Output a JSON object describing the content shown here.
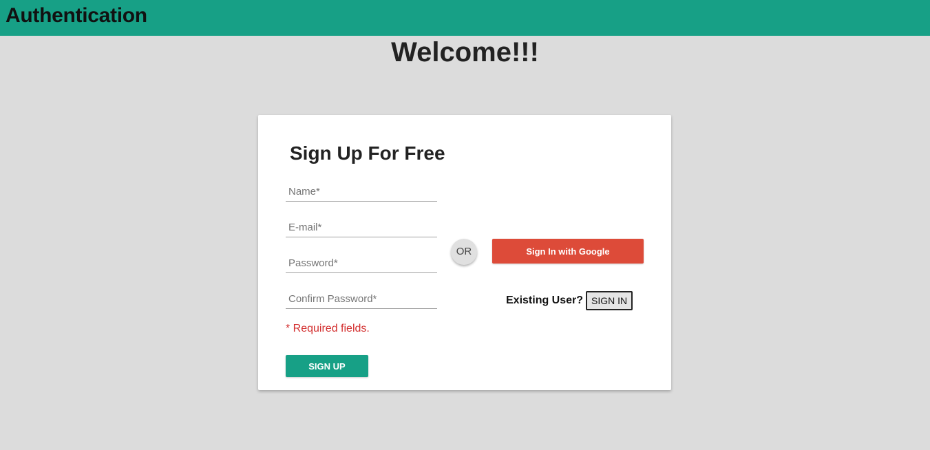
{
  "header": {
    "title": "Authentication",
    "color": "#17a086"
  },
  "welcome": "Welcome!!!",
  "signup_form": {
    "title": "Sign Up For Free",
    "fields": [
      {
        "placeholder": "Name*",
        "value": ""
      },
      {
        "placeholder": "E-mail*",
        "value": ""
      },
      {
        "placeholder": "Password*",
        "value": ""
      },
      {
        "placeholder": "Confirm Password*",
        "value": ""
      }
    ],
    "required_note": "* Required fields.",
    "submit_label": "SIGN UP"
  },
  "divider_label": "OR",
  "google": {
    "label": "Sign In with Google",
    "color": "#dd4b39"
  },
  "existing": {
    "label": "Existing User?",
    "button_label": "SIGN IN"
  }
}
